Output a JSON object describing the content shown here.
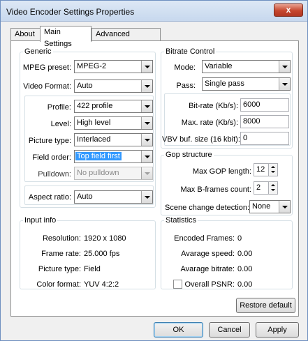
{
  "window": {
    "title": "Video Encoder Settings Properties",
    "close_glyph": "x"
  },
  "tabs": [
    "About",
    "Main Settings",
    "Advanced Settings"
  ],
  "generic": {
    "legend": "Generic",
    "mpeg_preset": {
      "label": "MPEG preset:",
      "value": "MPEG-2"
    },
    "video_format": {
      "label": "Video Format:",
      "value": "Auto"
    },
    "profile": {
      "label": "Profile:",
      "value": "422 profile"
    },
    "level": {
      "label": "Level:",
      "value": "High level"
    },
    "picture_type": {
      "label": "Picture type:",
      "value": "Interlaced"
    },
    "field_order": {
      "label": "Field order:",
      "value": "Top field first"
    },
    "pulldown": {
      "label": "Pulldown:",
      "value": "No pulldown"
    },
    "aspect_ratio": {
      "label": "Aspect ratio:",
      "value": "Auto"
    }
  },
  "bitrate": {
    "legend": "Bitrate Control",
    "mode": {
      "label": "Mode:",
      "value": "Variable"
    },
    "pass": {
      "label": "Pass:",
      "value": "Single pass"
    },
    "bit_rate": {
      "label": "Bit-rate (Kb/s):",
      "value": "6000"
    },
    "max_rate": {
      "label": "Max. rate (Kb/s):",
      "value": "8000"
    },
    "vbv": {
      "label": "VBV buf. size (16 kbit):",
      "value": "0"
    }
  },
  "gop": {
    "legend": "Gop structure",
    "max_gop": {
      "label": "Max GOP length:",
      "value": "12"
    },
    "max_b": {
      "label": "Max B-frames count:",
      "value": "2"
    },
    "scene": {
      "label": "Scene change detection:",
      "value": "None"
    }
  },
  "input_info": {
    "legend": "Input info",
    "rows": [
      {
        "label": "Resolution:",
        "value": "1920 x 1080"
      },
      {
        "label": "Frame rate:",
        "value": "25.000 fps"
      },
      {
        "label": "Picture type:",
        "value": "Field"
      },
      {
        "label": "Color format:",
        "value": "YUV 4:2:2"
      }
    ]
  },
  "statistics": {
    "legend": "Statistics",
    "encoded": {
      "label": "Encoded Frames:",
      "value": "0"
    },
    "speed": {
      "label": "Avarage speed:",
      "value": "0.00"
    },
    "bitrate": {
      "label": "Avarage bitrate:",
      "value": "0.00"
    },
    "psnr": {
      "label": "Overall PSNR:",
      "value": "0.00",
      "checked": false
    }
  },
  "buttons": {
    "restore": "Restore default",
    "ok": "OK",
    "cancel": "Cancel",
    "apply": "Apply"
  },
  "colors": {
    "selection": "#3399ff",
    "close_button": "#c6472e"
  }
}
